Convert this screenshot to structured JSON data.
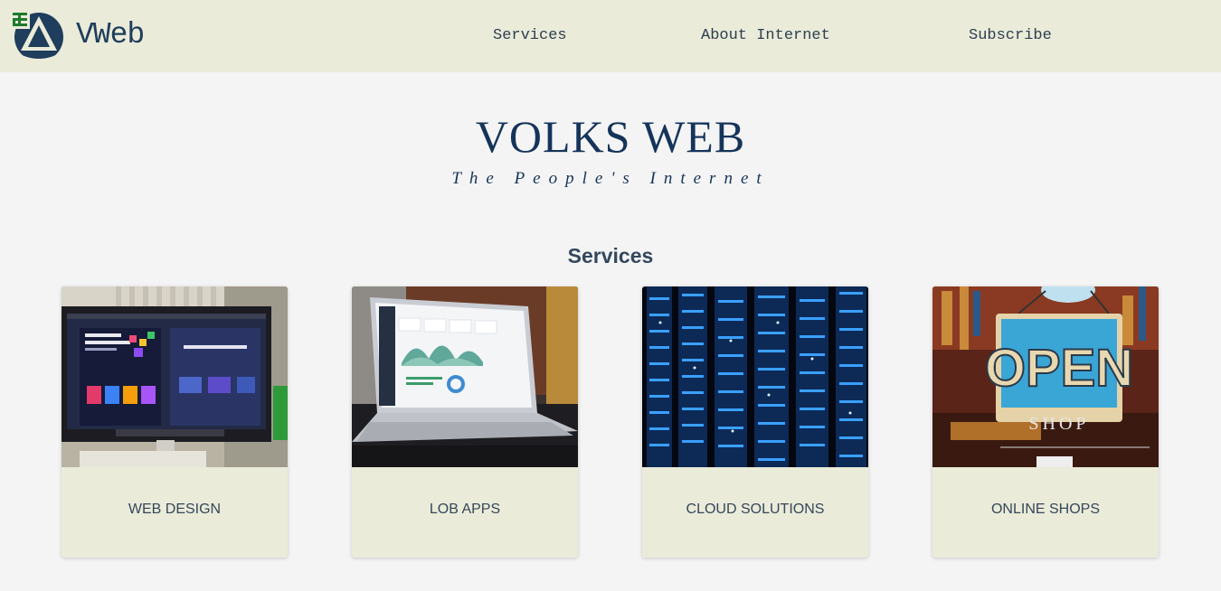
{
  "nav": {
    "brand": "VWeb",
    "links": [
      {
        "label": "Services"
      },
      {
        "label": "About Internet"
      },
      {
        "label": "Subscribe"
      }
    ]
  },
  "hero": {
    "title": "VOLKS WEB",
    "tagline": "The People's Internet"
  },
  "services": {
    "heading": "Services",
    "cards": [
      {
        "label": "WEB DESIGN",
        "image": "monitor-web-design-photo"
      },
      {
        "label": "LOB APPS",
        "image": "laptop-dashboard-photo"
      },
      {
        "label": "CLOUD SOLUTIONS",
        "image": "server-rack-lights-photo"
      },
      {
        "label": "ONLINE SHOPS",
        "image": "open-shop-sign-photo"
      }
    ]
  },
  "colors": {
    "navbar_bg": "#eaebd9",
    "page_bg": "#f4f4f4",
    "brand_navy": "#15345a"
  }
}
